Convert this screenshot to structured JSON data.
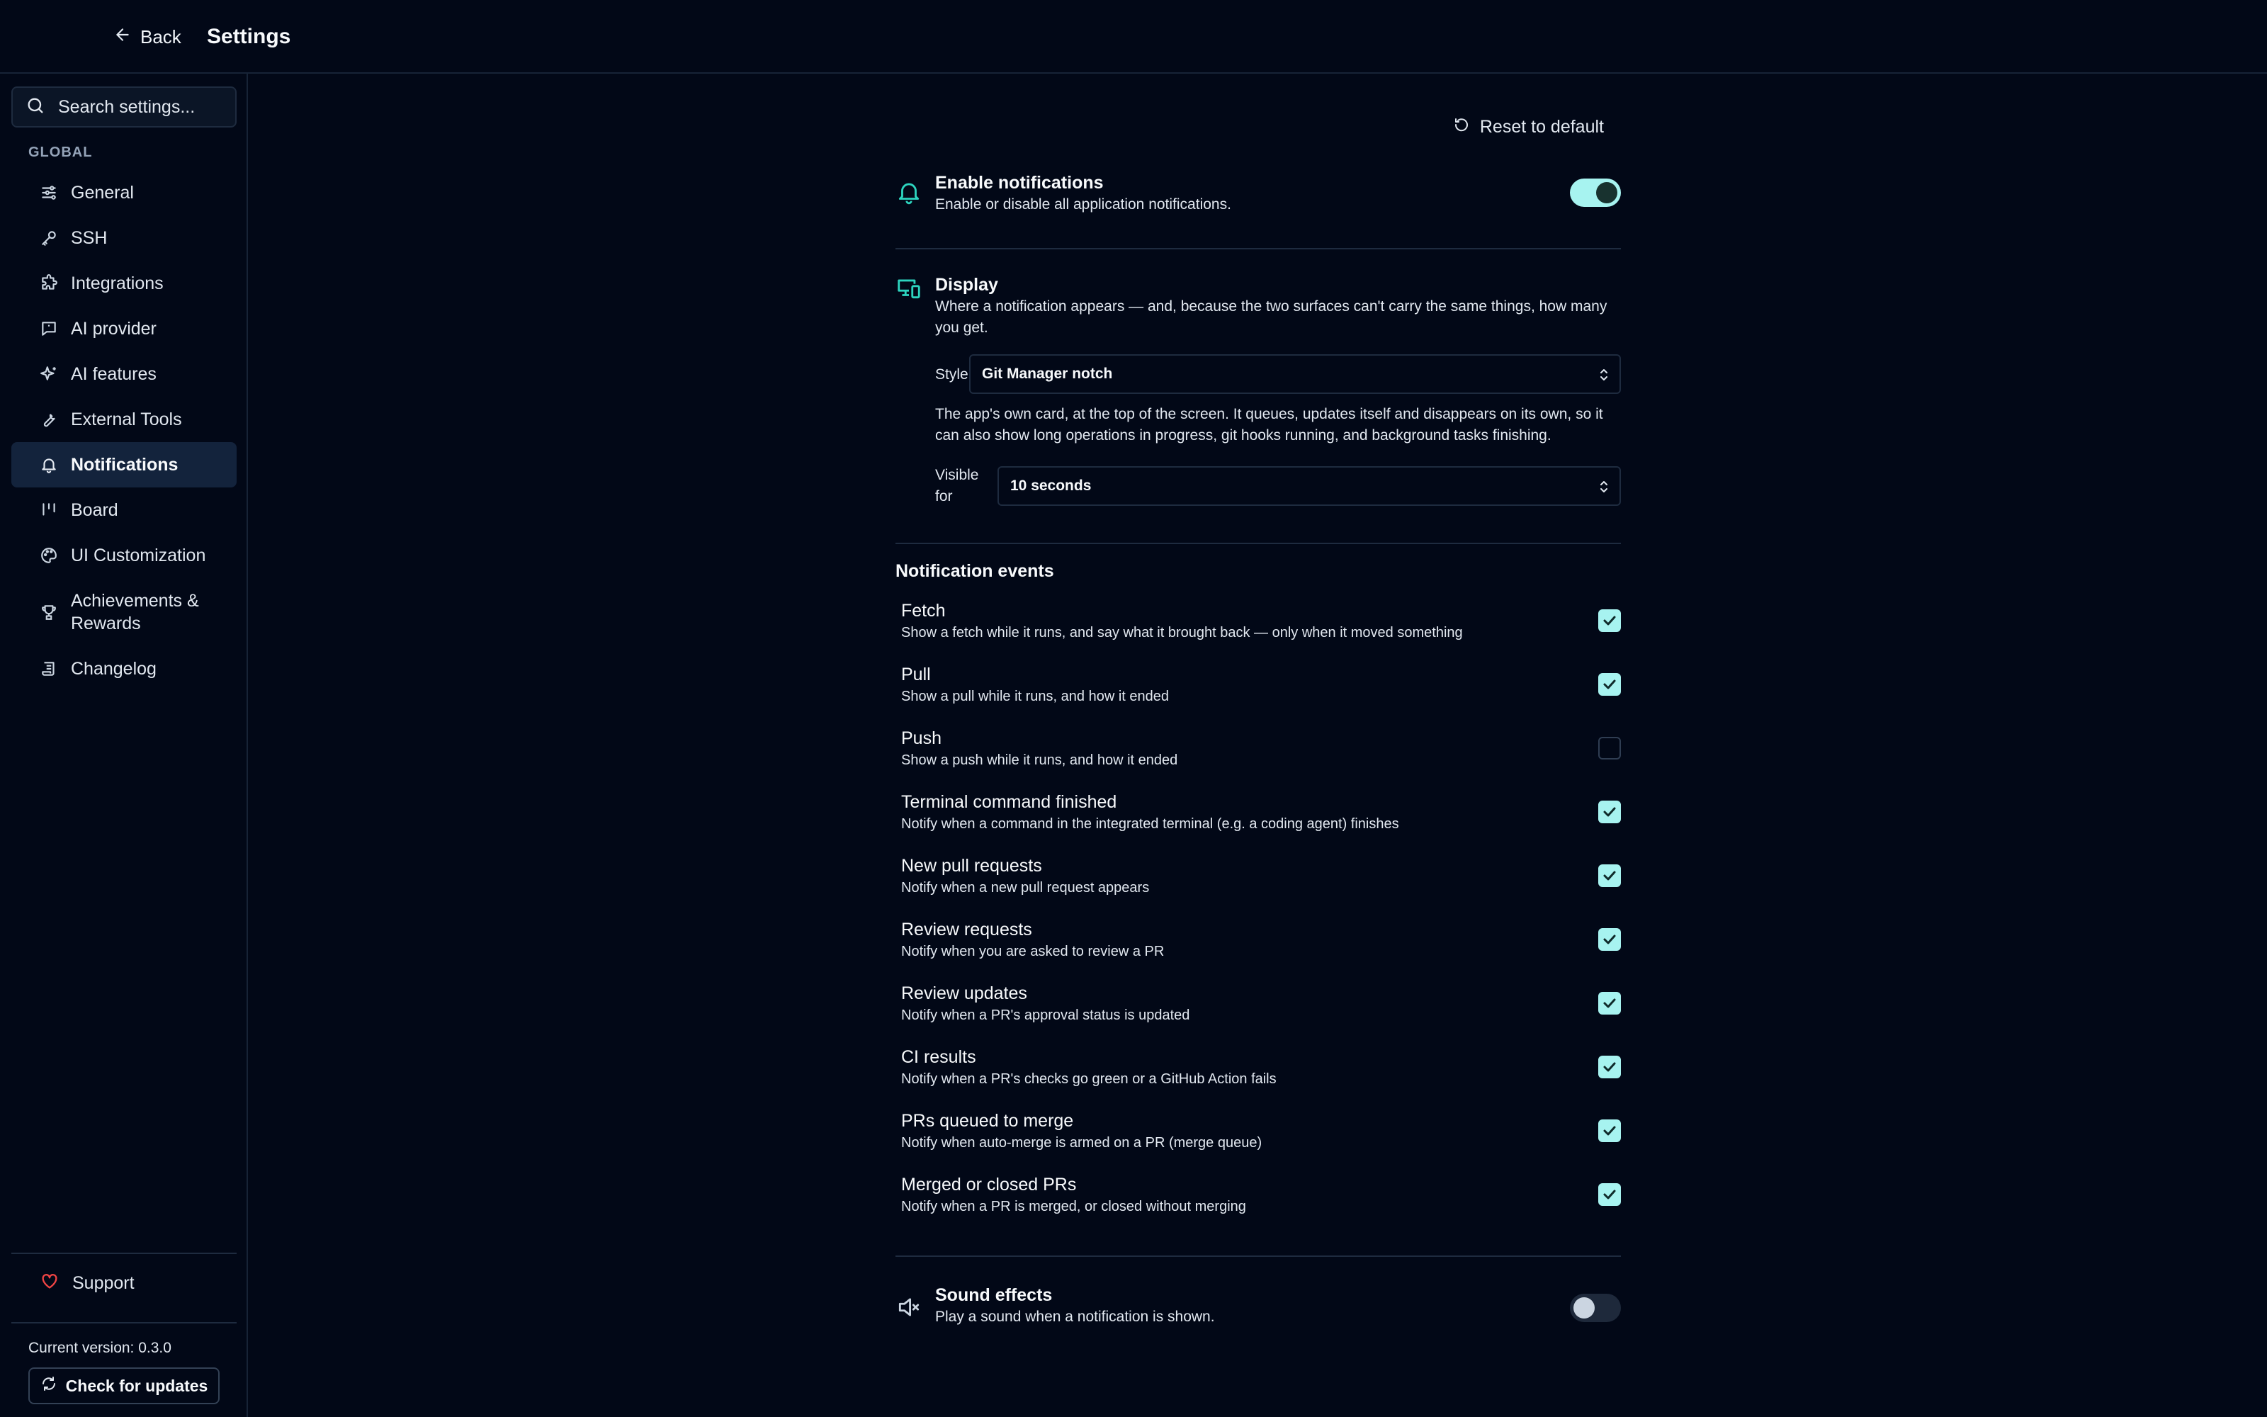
{
  "header": {
    "back_label": "Back",
    "title": "Settings"
  },
  "sidebar": {
    "search_placeholder": "Search settings...",
    "section_label": "GLOBAL",
    "items": [
      {
        "label": "General",
        "icon": "sliders-icon"
      },
      {
        "label": "SSH",
        "icon": "key-icon"
      },
      {
        "label": "Integrations",
        "icon": "puzzle-icon"
      },
      {
        "label": "AI provider",
        "icon": "message-icon"
      },
      {
        "label": "AI features",
        "icon": "sparkles-icon"
      },
      {
        "label": "External Tools",
        "icon": "wrench-icon"
      },
      {
        "label": "Notifications",
        "icon": "bell-icon",
        "active": true
      },
      {
        "label": "Board",
        "icon": "kanban-icon"
      },
      {
        "label": "UI Customization",
        "icon": "palette-icon"
      },
      {
        "label": "Achievements & Rewards",
        "icon": "trophy-icon"
      },
      {
        "label": "Changelog",
        "icon": "scroll-icon"
      }
    ],
    "support_label": "Support",
    "version_text": "Current version: 0.3.0",
    "check_updates_label": "Check for updates"
  },
  "main": {
    "reset_label": "Reset to default",
    "enable": {
      "title": "Enable notifications",
      "description": "Enable or disable all application notifications.",
      "enabled": true
    },
    "display": {
      "title": "Display",
      "description": "Where a notification appears — and, because the two surfaces can't carry the same things, how many you get.",
      "style_label": "Style",
      "style_value": "Git Manager notch",
      "style_description": "The app's own card, at the top of the screen. It queues, updates itself and disappears on its own, so it can also show long operations in progress, git hooks running, and background tasks finishing.",
      "visible_label": "Visible for",
      "visible_value": "10 seconds"
    },
    "events_title": "Notification events",
    "events": [
      {
        "title": "Fetch",
        "description": "Show a fetch while it runs, and say what it brought back — only when it moved something",
        "checked": true
      },
      {
        "title": "Pull",
        "description": "Show a pull while it runs, and how it ended",
        "checked": true
      },
      {
        "title": "Push",
        "description": "Show a push while it runs, and how it ended",
        "checked": false
      },
      {
        "title": "Terminal command finished",
        "description": "Notify when a command in the integrated terminal (e.g. a coding agent) finishes",
        "checked": true
      },
      {
        "title": "New pull requests",
        "description": "Notify when a new pull request appears",
        "checked": true
      },
      {
        "title": "Review requests",
        "description": "Notify when you are asked to review a PR",
        "checked": true
      },
      {
        "title": "Review updates",
        "description": "Notify when a PR's approval status is updated",
        "checked": true
      },
      {
        "title": "CI results",
        "description": "Notify when a PR's checks go green or a GitHub Action fails",
        "checked": true
      },
      {
        "title": "PRs queued to merge",
        "description": "Notify when auto-merge is armed on a PR (merge queue)",
        "checked": true
      },
      {
        "title": "Merged or closed PRs",
        "description": "Notify when a PR is merged, or closed without merging",
        "checked": true
      }
    ],
    "sound": {
      "title": "Sound effects",
      "description": "Play a sound when a notification is shown.",
      "enabled": false
    }
  },
  "colors": {
    "background": "#020817",
    "accent": "#a7f3f0",
    "accent_icon": "#2dd4bf",
    "border": "#1e2b3f",
    "support_heart": "#ef4444"
  }
}
